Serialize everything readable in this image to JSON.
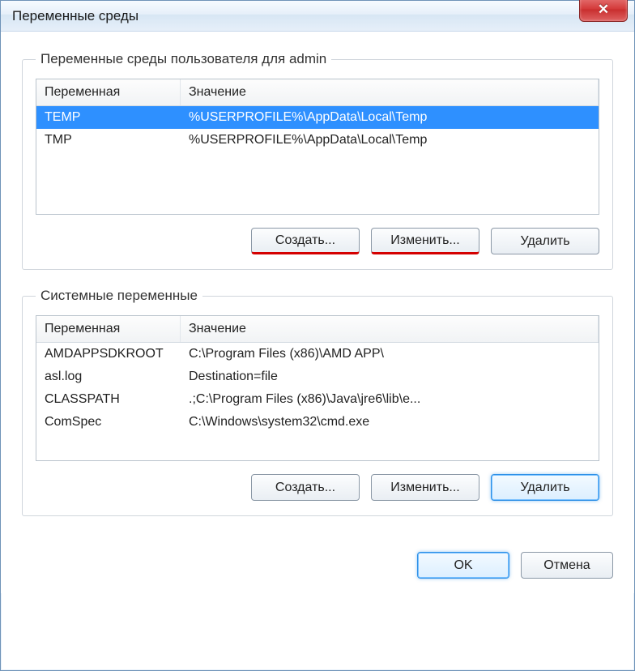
{
  "window": {
    "title": "Переменные среды",
    "close_glyph": "✕"
  },
  "user_group": {
    "legend": "Переменные среды пользователя для admin",
    "columns": {
      "var": "Переменная",
      "val": "Значение"
    },
    "rows": [
      {
        "var": "TEMP",
        "val": "%USERPROFILE%\\AppData\\Local\\Temp",
        "selected": true
      },
      {
        "var": "TMP",
        "val": "%USERPROFILE%\\AppData\\Local\\Temp",
        "selected": false
      }
    ],
    "buttons": {
      "create": "Создать...",
      "edit": "Изменить...",
      "delete": "Удалить"
    }
  },
  "system_group": {
    "legend": "Системные переменные",
    "columns": {
      "var": "Переменная",
      "val": "Значение"
    },
    "rows": [
      {
        "var": "AMDAPPSDKROOT",
        "val": "C:\\Program Files (x86)\\AMD APP\\"
      },
      {
        "var": "asl.log",
        "val": "Destination=file"
      },
      {
        "var": "CLASSPATH",
        "val": ".;C:\\Program Files (x86)\\Java\\jre6\\lib\\e..."
      },
      {
        "var": "ComSpec",
        "val": "C:\\Windows\\system32\\cmd.exe"
      }
    ],
    "buttons": {
      "create": "Создать...",
      "edit": "Изменить...",
      "delete": "Удалить"
    }
  },
  "footer": {
    "ok": "OK",
    "cancel": "Отмена"
  }
}
